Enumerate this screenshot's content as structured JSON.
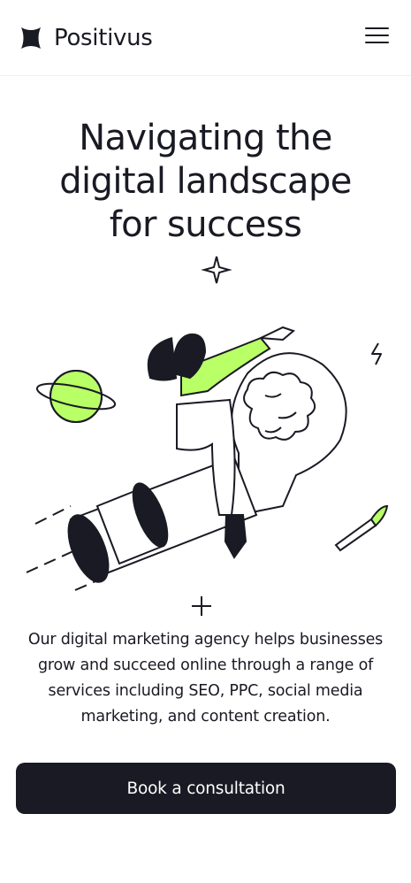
{
  "brand": {
    "name": "Positivus"
  },
  "nav": {
    "menu_icon": "hamburger-menu-icon"
  },
  "hero": {
    "headline_lines": [
      "Navigating the",
      "digital landscape",
      "for success"
    ],
    "illustration": "woman-riding-rocket-lightbulb-illustration",
    "description": "Our digital marketing agency helps businesses grow and succeed online through a range of services including SEO, PPC, social media marketing, and content creation.",
    "cta_label": "Book a consultation"
  },
  "colors": {
    "accent": "#B9FF66",
    "dark": "#191A23",
    "background": "#FFFFFF"
  }
}
